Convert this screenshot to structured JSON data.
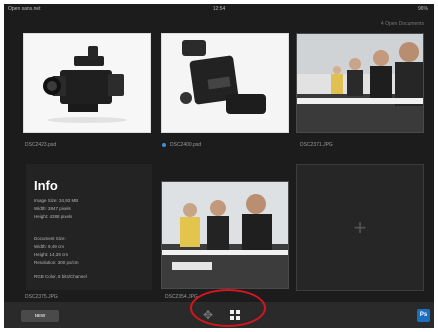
{
  "status_bar": {
    "carrier": "Open sans.net",
    "time": "12:54",
    "battery": "96%"
  },
  "header": {
    "open_documents": "4 Open Documents"
  },
  "documents": [
    {
      "name": "DSC2423.psd",
      "thumb": "camcorder-photo"
    },
    {
      "name": "DSC2400.psd",
      "thumb": "recorder-photo",
      "marked": true
    },
    {
      "name": "DSC2371.JPG",
      "thumb": "meeting-photo"
    },
    {
      "name": "DSC2375.JPG",
      "thumb": "info"
    },
    {
      "name": "DSC2354.JPG",
      "thumb": "meeting-photo-2"
    }
  ],
  "info": {
    "title": "Info",
    "image_size": "Image Size: 34,93 MB",
    "width": "Width: 2847 pixels",
    "height": "Height: 4288 pixels",
    "document_size": "Document Size:",
    "doc_width": "Width: 9,49 cm",
    "doc_height": "Height: 14,29 cm",
    "resolution": "Resolution: 300 px/cm",
    "color": "RGB Color, 8 bits/Channel"
  },
  "add_card": {
    "symbol": "+"
  },
  "toolbar": {
    "new_label": "NEW",
    "move_symbol": "✥",
    "app_label": "Ps"
  },
  "colors": {
    "background": "#1c1c1c",
    "accent_dot": "#3a8fd6",
    "highlight_ring": "#d8141e",
    "app_icon": "#1b6fc0"
  }
}
